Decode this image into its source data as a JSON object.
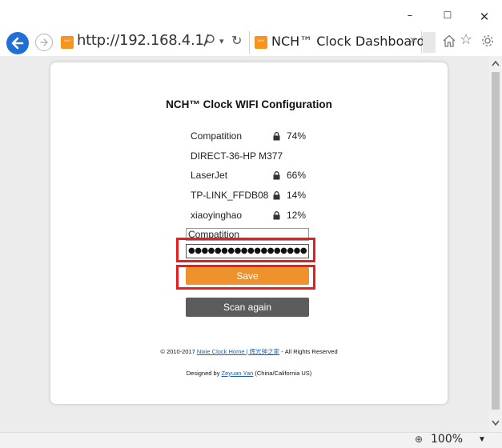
{
  "window_controls": {
    "minimize": "–",
    "maximize": "☐",
    "close": "✕"
  },
  "toolbar": {
    "favicon_text": "ᴺᶜᴴ",
    "address": "http://192.168.4.1/",
    "search_glyph": "⌕",
    "dropdown_glyph": "▾",
    "refresh_glyph": "↻",
    "tab_title": "NCH™ Clock Dashboard",
    "tab_close": "×",
    "star_glyph": "☆"
  },
  "page": {
    "title": "NCH™ Clock WIFI Configuration",
    "networks": [
      {
        "name": "Compatition",
        "locked": true,
        "signal": "74%"
      },
      {
        "name": "DIRECT-36-HP M377",
        "locked": false,
        "signal": ""
      },
      {
        "name": "LaserJet",
        "locked": true,
        "signal": "66%"
      },
      {
        "name": "TP-LINK_FFDB08",
        "locked": true,
        "signal": "14%"
      },
      {
        "name": "xiaoyinghao",
        "locked": true,
        "signal": "12%"
      }
    ],
    "ssid_value": "Compatition",
    "password_value": "●●●●●●●●●●●●●●●●●●",
    "save_label": "Save",
    "scan_label": "Scan again",
    "footer": {
      "copyright_prefix": "© 2010-2017 ",
      "home_link": "Nixie Clock Home | 辉光钟之家",
      "copyright_suffix": " - All Rights Reserved",
      "designed_prefix": "Designed by ",
      "designer_link": "Zeyuan Yan",
      "designed_suffix": " (China/California US)"
    }
  },
  "statusbar": {
    "zoom": "100%",
    "zoom_glyph": "⊕",
    "zoom_dropdown": "▼"
  },
  "colors": {
    "save_button": "#ef922e",
    "scan_button": "#5c5c5c",
    "highlight": "#e61e1e",
    "back_button": "#1f6fd6",
    "favicon": "#f7931e"
  }
}
